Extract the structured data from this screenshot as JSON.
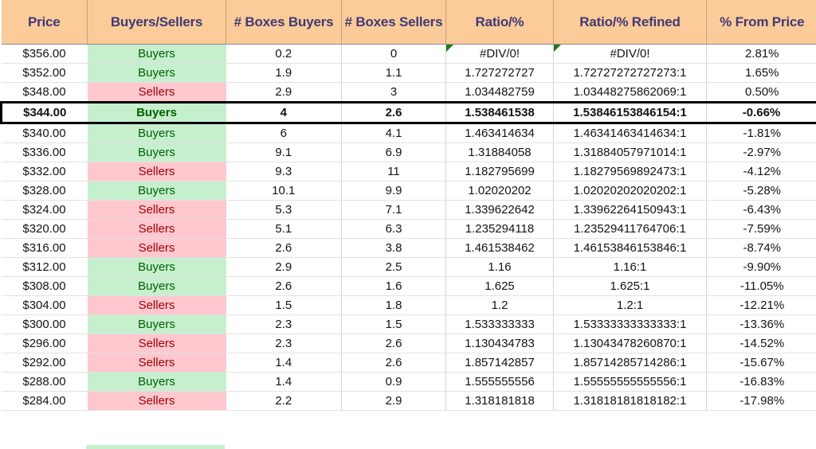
{
  "table": {
    "columns": [
      {
        "key": "price",
        "label": "Price"
      },
      {
        "key": "side",
        "label": "Buyers/Sellers"
      },
      {
        "key": "bbuy",
        "label": "# Boxes Buyers"
      },
      {
        "key": "bsell",
        "label": "# Boxes Sellers"
      },
      {
        "key": "ratio",
        "label": "Ratio/%"
      },
      {
        "key": "refined",
        "label": "Ratio/% Refined"
      },
      {
        "key": "pct",
        "label": "% From Price"
      }
    ],
    "colors": {
      "header_fill": "#FCCB9A",
      "header_text": "#3F3A75",
      "buyers_fill": "#C6EFCE",
      "buyers_text": "#006100",
      "sellers_fill": "#FFC7CE",
      "sellers_text": "#9C0006",
      "grid_line": "#D4D4D4",
      "selection_border": "#000000",
      "error_triangle": "#1B7A1B"
    },
    "rows": [
      {
        "price": "$356.00",
        "side": "Buyers",
        "bbuy": "0.2",
        "bsell": "0",
        "ratio": "#DIV/0!",
        "refined": "#DIV/0!",
        "pct": "2.81%",
        "side_state": "buy",
        "error": true,
        "selected": false
      },
      {
        "price": "$352.00",
        "side": "Buyers",
        "bbuy": "1.9",
        "bsell": "1.1",
        "ratio": "1.727272727",
        "refined": "1.72727272727273:1",
        "pct": "1.65%",
        "side_state": "buy",
        "error": false,
        "selected": false
      },
      {
        "price": "$348.00",
        "side": "Sellers",
        "bbuy": "2.9",
        "bsell": "3",
        "ratio": "1.034482759",
        "refined": "1.03448275862069:1",
        "pct": "0.50%",
        "side_state": "sell",
        "error": false,
        "selected": false
      },
      {
        "price": "$344.00",
        "side": "Buyers",
        "bbuy": "4",
        "bsell": "2.6",
        "ratio": "1.538461538",
        "refined": "1.53846153846154:1",
        "pct": "-0.66%",
        "side_state": "buy",
        "error": false,
        "selected": true
      },
      {
        "price": "$340.00",
        "side": "Buyers",
        "bbuy": "6",
        "bsell": "4.1",
        "ratio": "1.463414634",
        "refined": "1.46341463414634:1",
        "pct": "-1.81%",
        "side_state": "buy",
        "error": false,
        "selected": false
      },
      {
        "price": "$336.00",
        "side": "Buyers",
        "bbuy": "9.1",
        "bsell": "6.9",
        "ratio": "1.31884058",
        "refined": "1.31884057971014:1",
        "pct": "-2.97%",
        "side_state": "buy",
        "error": false,
        "selected": false
      },
      {
        "price": "$332.00",
        "side": "Sellers",
        "bbuy": "9.3",
        "bsell": "11",
        "ratio": "1.182795699",
        "refined": "1.18279569892473:1",
        "pct": "-4.12%",
        "side_state": "sell",
        "error": false,
        "selected": false
      },
      {
        "price": "$328.00",
        "side": "Buyers",
        "bbuy": "10.1",
        "bsell": "9.9",
        "ratio": "1.02020202",
        "refined": "1.02020202020202:1",
        "pct": "-5.28%",
        "side_state": "buy",
        "error": false,
        "selected": false
      },
      {
        "price": "$324.00",
        "side": "Sellers",
        "bbuy": "5.3",
        "bsell": "7.1",
        "ratio": "1.339622642",
        "refined": "1.33962264150943:1",
        "pct": "-6.43%",
        "side_state": "sell",
        "error": false,
        "selected": false
      },
      {
        "price": "$320.00",
        "side": "Sellers",
        "bbuy": "5.1",
        "bsell": "6.3",
        "ratio": "1.235294118",
        "refined": "1.23529411764706:1",
        "pct": "-7.59%",
        "side_state": "sell",
        "error": false,
        "selected": false
      },
      {
        "price": "$316.00",
        "side": "Sellers",
        "bbuy": "2.6",
        "bsell": "3.8",
        "ratio": "1.461538462",
        "refined": "1.46153846153846:1",
        "pct": "-8.74%",
        "side_state": "sell",
        "error": false,
        "selected": false
      },
      {
        "price": "$312.00",
        "side": "Buyers",
        "bbuy": "2.9",
        "bsell": "2.5",
        "ratio": "1.16",
        "refined": "1.16:1",
        "pct": "-9.90%",
        "side_state": "buy",
        "error": false,
        "selected": false
      },
      {
        "price": "$308.00",
        "side": "Buyers",
        "bbuy": "2.6",
        "bsell": "1.6",
        "ratio": "1.625",
        "refined": "1.625:1",
        "pct": "-11.05%",
        "side_state": "buy",
        "error": false,
        "selected": false
      },
      {
        "price": "$304.00",
        "side": "Sellers",
        "bbuy": "1.5",
        "bsell": "1.8",
        "ratio": "1.2",
        "refined": "1.2:1",
        "pct": "-12.21%",
        "side_state": "sell",
        "error": false,
        "selected": false
      },
      {
        "price": "$300.00",
        "side": "Buyers",
        "bbuy": "2.3",
        "bsell": "1.5",
        "ratio": "1.533333333",
        "refined": "1.53333333333333:1",
        "pct": "-13.36%",
        "side_state": "buy",
        "error": false,
        "selected": false
      },
      {
        "price": "$296.00",
        "side": "Sellers",
        "bbuy": "2.3",
        "bsell": "2.6",
        "ratio": "1.130434783",
        "refined": "1.13043478260870:1",
        "pct": "-14.52%",
        "side_state": "sell",
        "error": false,
        "selected": false
      },
      {
        "price": "$292.00",
        "side": "Sellers",
        "bbuy": "1.4",
        "bsell": "2.6",
        "ratio": "1.857142857",
        "refined": "1.85714285714286:1",
        "pct": "-15.67%",
        "side_state": "sell",
        "error": false,
        "selected": false
      },
      {
        "price": "$288.00",
        "side": "Buyers",
        "bbuy": "1.4",
        "bsell": "0.9",
        "ratio": "1.555555556",
        "refined": "1.55555555555556:1",
        "pct": "-16.83%",
        "side_state": "buy",
        "error": false,
        "selected": false
      },
      {
        "price": "$284.00",
        "side": "Sellers",
        "bbuy": "2.2",
        "bsell": "2.9",
        "ratio": "1.318181818",
        "refined": "1.31818181818182:1",
        "pct": "-17.98%",
        "side_state": "sell",
        "error": false,
        "selected": false
      }
    ]
  }
}
